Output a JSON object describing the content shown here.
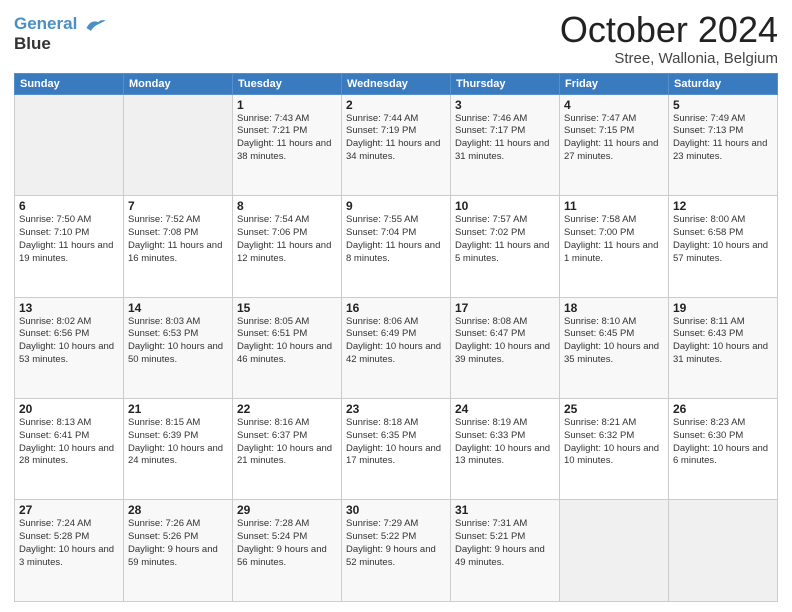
{
  "header": {
    "logo_line1": "General",
    "logo_line2": "Blue",
    "title": "October 2024",
    "subtitle": "Stree, Wallonia, Belgium"
  },
  "weekdays": [
    "Sunday",
    "Monday",
    "Tuesday",
    "Wednesday",
    "Thursday",
    "Friday",
    "Saturday"
  ],
  "weeks": [
    [
      {
        "day": "",
        "sunrise": "",
        "sunset": "",
        "daylight": ""
      },
      {
        "day": "",
        "sunrise": "",
        "sunset": "",
        "daylight": ""
      },
      {
        "day": "1",
        "sunrise": "Sunrise: 7:43 AM",
        "sunset": "Sunset: 7:21 PM",
        "daylight": "Daylight: 11 hours and 38 minutes."
      },
      {
        "day": "2",
        "sunrise": "Sunrise: 7:44 AM",
        "sunset": "Sunset: 7:19 PM",
        "daylight": "Daylight: 11 hours and 34 minutes."
      },
      {
        "day": "3",
        "sunrise": "Sunrise: 7:46 AM",
        "sunset": "Sunset: 7:17 PM",
        "daylight": "Daylight: 11 hours and 31 minutes."
      },
      {
        "day": "4",
        "sunrise": "Sunrise: 7:47 AM",
        "sunset": "Sunset: 7:15 PM",
        "daylight": "Daylight: 11 hours and 27 minutes."
      },
      {
        "day": "5",
        "sunrise": "Sunrise: 7:49 AM",
        "sunset": "Sunset: 7:13 PM",
        "daylight": "Daylight: 11 hours and 23 minutes."
      }
    ],
    [
      {
        "day": "6",
        "sunrise": "Sunrise: 7:50 AM",
        "sunset": "Sunset: 7:10 PM",
        "daylight": "Daylight: 11 hours and 19 minutes."
      },
      {
        "day": "7",
        "sunrise": "Sunrise: 7:52 AM",
        "sunset": "Sunset: 7:08 PM",
        "daylight": "Daylight: 11 hours and 16 minutes."
      },
      {
        "day": "8",
        "sunrise": "Sunrise: 7:54 AM",
        "sunset": "Sunset: 7:06 PM",
        "daylight": "Daylight: 11 hours and 12 minutes."
      },
      {
        "day": "9",
        "sunrise": "Sunrise: 7:55 AM",
        "sunset": "Sunset: 7:04 PM",
        "daylight": "Daylight: 11 hours and 8 minutes."
      },
      {
        "day": "10",
        "sunrise": "Sunrise: 7:57 AM",
        "sunset": "Sunset: 7:02 PM",
        "daylight": "Daylight: 11 hours and 5 minutes."
      },
      {
        "day": "11",
        "sunrise": "Sunrise: 7:58 AM",
        "sunset": "Sunset: 7:00 PM",
        "daylight": "Daylight: 11 hours and 1 minute."
      },
      {
        "day": "12",
        "sunrise": "Sunrise: 8:00 AM",
        "sunset": "Sunset: 6:58 PM",
        "daylight": "Daylight: 10 hours and 57 minutes."
      }
    ],
    [
      {
        "day": "13",
        "sunrise": "Sunrise: 8:02 AM",
        "sunset": "Sunset: 6:56 PM",
        "daylight": "Daylight: 10 hours and 53 minutes."
      },
      {
        "day": "14",
        "sunrise": "Sunrise: 8:03 AM",
        "sunset": "Sunset: 6:53 PM",
        "daylight": "Daylight: 10 hours and 50 minutes."
      },
      {
        "day": "15",
        "sunrise": "Sunrise: 8:05 AM",
        "sunset": "Sunset: 6:51 PM",
        "daylight": "Daylight: 10 hours and 46 minutes."
      },
      {
        "day": "16",
        "sunrise": "Sunrise: 8:06 AM",
        "sunset": "Sunset: 6:49 PM",
        "daylight": "Daylight: 10 hours and 42 minutes."
      },
      {
        "day": "17",
        "sunrise": "Sunrise: 8:08 AM",
        "sunset": "Sunset: 6:47 PM",
        "daylight": "Daylight: 10 hours and 39 minutes."
      },
      {
        "day": "18",
        "sunrise": "Sunrise: 8:10 AM",
        "sunset": "Sunset: 6:45 PM",
        "daylight": "Daylight: 10 hours and 35 minutes."
      },
      {
        "day": "19",
        "sunrise": "Sunrise: 8:11 AM",
        "sunset": "Sunset: 6:43 PM",
        "daylight": "Daylight: 10 hours and 31 minutes."
      }
    ],
    [
      {
        "day": "20",
        "sunrise": "Sunrise: 8:13 AM",
        "sunset": "Sunset: 6:41 PM",
        "daylight": "Daylight: 10 hours and 28 minutes."
      },
      {
        "day": "21",
        "sunrise": "Sunrise: 8:15 AM",
        "sunset": "Sunset: 6:39 PM",
        "daylight": "Daylight: 10 hours and 24 minutes."
      },
      {
        "day": "22",
        "sunrise": "Sunrise: 8:16 AM",
        "sunset": "Sunset: 6:37 PM",
        "daylight": "Daylight: 10 hours and 21 minutes."
      },
      {
        "day": "23",
        "sunrise": "Sunrise: 8:18 AM",
        "sunset": "Sunset: 6:35 PM",
        "daylight": "Daylight: 10 hours and 17 minutes."
      },
      {
        "day": "24",
        "sunrise": "Sunrise: 8:19 AM",
        "sunset": "Sunset: 6:33 PM",
        "daylight": "Daylight: 10 hours and 13 minutes."
      },
      {
        "day": "25",
        "sunrise": "Sunrise: 8:21 AM",
        "sunset": "Sunset: 6:32 PM",
        "daylight": "Daylight: 10 hours and 10 minutes."
      },
      {
        "day": "26",
        "sunrise": "Sunrise: 8:23 AM",
        "sunset": "Sunset: 6:30 PM",
        "daylight": "Daylight: 10 hours and 6 minutes."
      }
    ],
    [
      {
        "day": "27",
        "sunrise": "Sunrise: 7:24 AM",
        "sunset": "Sunset: 5:28 PM",
        "daylight": "Daylight: 10 hours and 3 minutes."
      },
      {
        "day": "28",
        "sunrise": "Sunrise: 7:26 AM",
        "sunset": "Sunset: 5:26 PM",
        "daylight": "Daylight: 9 hours and 59 minutes."
      },
      {
        "day": "29",
        "sunrise": "Sunrise: 7:28 AM",
        "sunset": "Sunset: 5:24 PM",
        "daylight": "Daylight: 9 hours and 56 minutes."
      },
      {
        "day": "30",
        "sunrise": "Sunrise: 7:29 AM",
        "sunset": "Sunset: 5:22 PM",
        "daylight": "Daylight: 9 hours and 52 minutes."
      },
      {
        "day": "31",
        "sunrise": "Sunrise: 7:31 AM",
        "sunset": "Sunset: 5:21 PM",
        "daylight": "Daylight: 9 hours and 49 minutes."
      },
      {
        "day": "",
        "sunrise": "",
        "sunset": "",
        "daylight": ""
      },
      {
        "day": "",
        "sunrise": "",
        "sunset": "",
        "daylight": ""
      }
    ]
  ]
}
